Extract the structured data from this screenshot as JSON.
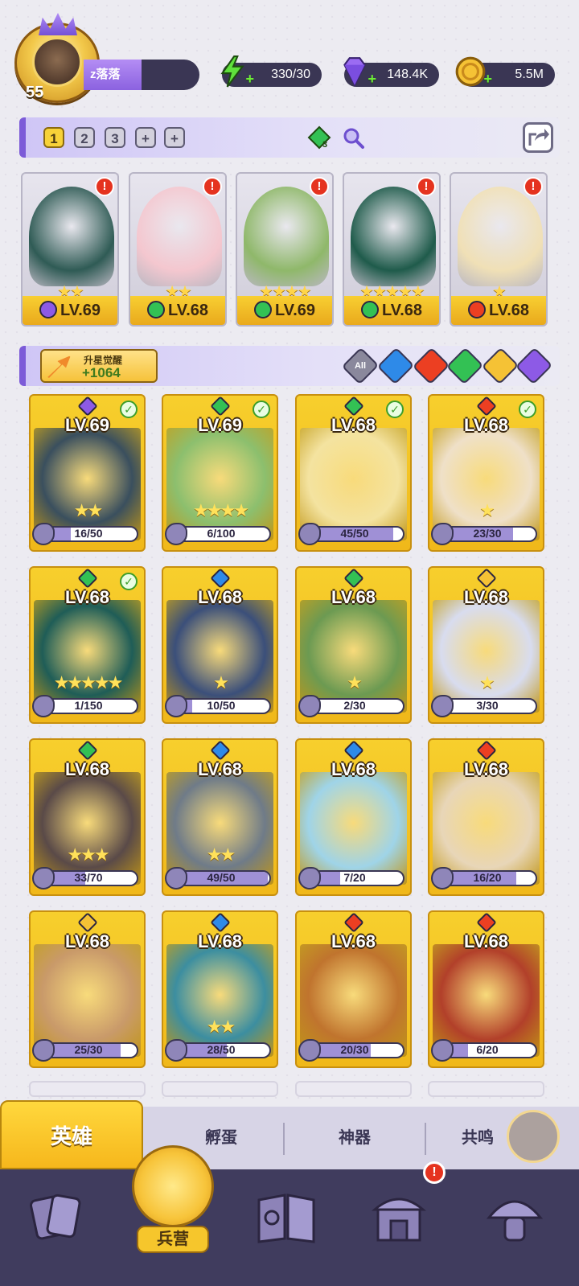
{
  "player": {
    "level": "55",
    "name": "z落落"
  },
  "resources": [
    {
      "name": "energy",
      "icon": "lightning-icon",
      "value": "330/30",
      "color": "#5fe03c"
    },
    {
      "name": "gems",
      "icon": "gem-icon",
      "value": "148.4K",
      "color": "#9b6cf2"
    },
    {
      "name": "gold",
      "icon": "coin-icon",
      "value": "5.5M",
      "color": "#f5c235"
    }
  ],
  "team": {
    "tabs": [
      "1",
      "2",
      "3",
      "+",
      "+"
    ],
    "active_tab": "1",
    "gem_count": "3"
  },
  "team_slots": [
    {
      "level": "LV.69",
      "element": "dark",
      "stars": "★★",
      "alert": "!",
      "art": "#2f5b55"
    },
    {
      "level": "LV.68",
      "element": "wind",
      "stars": "★★",
      "alert": "!",
      "art": "#f4c7cf"
    },
    {
      "level": "LV.69",
      "element": "wind",
      "stars": "★★★★",
      "alert": "!",
      "art": "#8fb86a"
    },
    {
      "level": "LV.68",
      "element": "wind",
      "stars": "★★★★★",
      "alert": "!",
      "art": "#1f5b4b"
    },
    {
      "level": "LV.68",
      "element": "fire",
      "stars": "★",
      "alert": "!",
      "art": "#f0e0b6"
    }
  ],
  "upgrade": {
    "label": "升星觉醒",
    "value": "+1064"
  },
  "filters": [
    {
      "name": "All",
      "color": "#8a889c",
      "label": "All"
    },
    {
      "name": "water",
      "color": "#2e8ae8",
      "label": ""
    },
    {
      "name": "fire",
      "color": "#ec3f22",
      "label": ""
    },
    {
      "name": "wind",
      "color": "#33c154",
      "label": ""
    },
    {
      "name": "light",
      "color": "#f5c235",
      "label": ""
    },
    {
      "name": "dark",
      "color": "#8d5ae6",
      "label": ""
    }
  ],
  "heroes": [
    {
      "level": "LV.69",
      "element": "dark",
      "stars": "★★",
      "progress": "16/50",
      "fraction": 0.32,
      "checked": true,
      "art": "#3a4f5e"
    },
    {
      "level": "LV.69",
      "element": "wind",
      "stars": "★★★★",
      "progress": "6/100",
      "fraction": 0.06,
      "checked": true,
      "art": "#8cbf6e"
    },
    {
      "level": "LV.68",
      "element": "wind",
      "stars": "",
      "progress": "45/50",
      "fraction": 0.9,
      "checked": true,
      "art": "#f4e3a0"
    },
    {
      "level": "LV.68",
      "element": "fire",
      "stars": "★",
      "progress": "23/30",
      "fraction": 0.77,
      "checked": true,
      "art": "#efe0c8"
    },
    {
      "level": "LV.68",
      "element": "wind",
      "stars": "★★★★★",
      "progress": "1/150",
      "fraction": 0.01,
      "checked": true,
      "art": "#1f5d57"
    },
    {
      "level": "LV.68",
      "element": "water",
      "stars": "★",
      "progress": "10/50",
      "fraction": 0.2,
      "checked": false,
      "art": "#3b4f7a"
    },
    {
      "level": "LV.68",
      "element": "wind",
      "stars": "★",
      "progress": "2/30",
      "fraction": 0.07,
      "checked": false,
      "art": "#6c9a52"
    },
    {
      "level": "LV.68",
      "element": "light",
      "stars": "★",
      "progress": "3/30",
      "fraction": 0.1,
      "checked": false,
      "art": "#d8dcef"
    },
    {
      "level": "LV.68",
      "element": "wind",
      "stars": "★★★",
      "progress": "33/70",
      "fraction": 0.47,
      "checked": false,
      "art": "#5a4a48"
    },
    {
      "level": "LV.68",
      "element": "water",
      "stars": "★★",
      "progress": "49/50",
      "fraction": 0.98,
      "checked": false,
      "art": "#6f7b88"
    },
    {
      "level": "LV.68",
      "element": "water",
      "stars": "",
      "progress": "7/20",
      "fraction": 0.35,
      "checked": false,
      "art": "#9fd4e8"
    },
    {
      "level": "LV.68",
      "element": "fire",
      "stars": "",
      "progress": "16/20",
      "fraction": 0.8,
      "checked": false,
      "art": "#e8d6b8"
    },
    {
      "level": "LV.68",
      "element": "light",
      "stars": "",
      "progress": "25/30",
      "fraction": 0.83,
      "checked": false,
      "art": "#c99a6a"
    },
    {
      "level": "LV.68",
      "element": "water",
      "stars": "★★",
      "progress": "28/50",
      "fraction": 0.56,
      "checked": false,
      "art": "#3c8ea0"
    },
    {
      "level": "LV.68",
      "element": "fire",
      "stars": "",
      "progress": "20/30",
      "fraction": 0.67,
      "checked": false,
      "art": "#c0742e"
    },
    {
      "level": "LV.68",
      "element": "fire",
      "stars": "",
      "progress": "6/20",
      "fraction": 0.3,
      "checked": false,
      "art": "#b2402a"
    }
  ],
  "tabs": [
    {
      "label": "英雄",
      "active": true
    },
    {
      "label": "孵蛋",
      "active": false
    },
    {
      "label": "神器",
      "active": false
    },
    {
      "label": "共鸣",
      "active": false
    }
  ],
  "bottom_nav": [
    {
      "name": "cards",
      "icon": "cards-icon",
      "label": ""
    },
    {
      "name": "barracks",
      "icon": "barracks-icon",
      "label": "兵营",
      "active": true
    },
    {
      "name": "map",
      "icon": "map-book-icon",
      "label": ""
    },
    {
      "name": "shop",
      "icon": "temple-icon",
      "label": "",
      "alert": "!"
    },
    {
      "name": "guild",
      "icon": "mushroom-icon",
      "label": ""
    }
  ],
  "colors": {
    "accent": "#7c5bd8",
    "card_gold": "#f7cf2d",
    "nav_bg": "#403c5e",
    "elements": {
      "dark": "#8d5ae6",
      "wind": "#33c154",
      "fire": "#ec3f22",
      "water": "#2e8ae8",
      "light": "#f5c235"
    }
  }
}
